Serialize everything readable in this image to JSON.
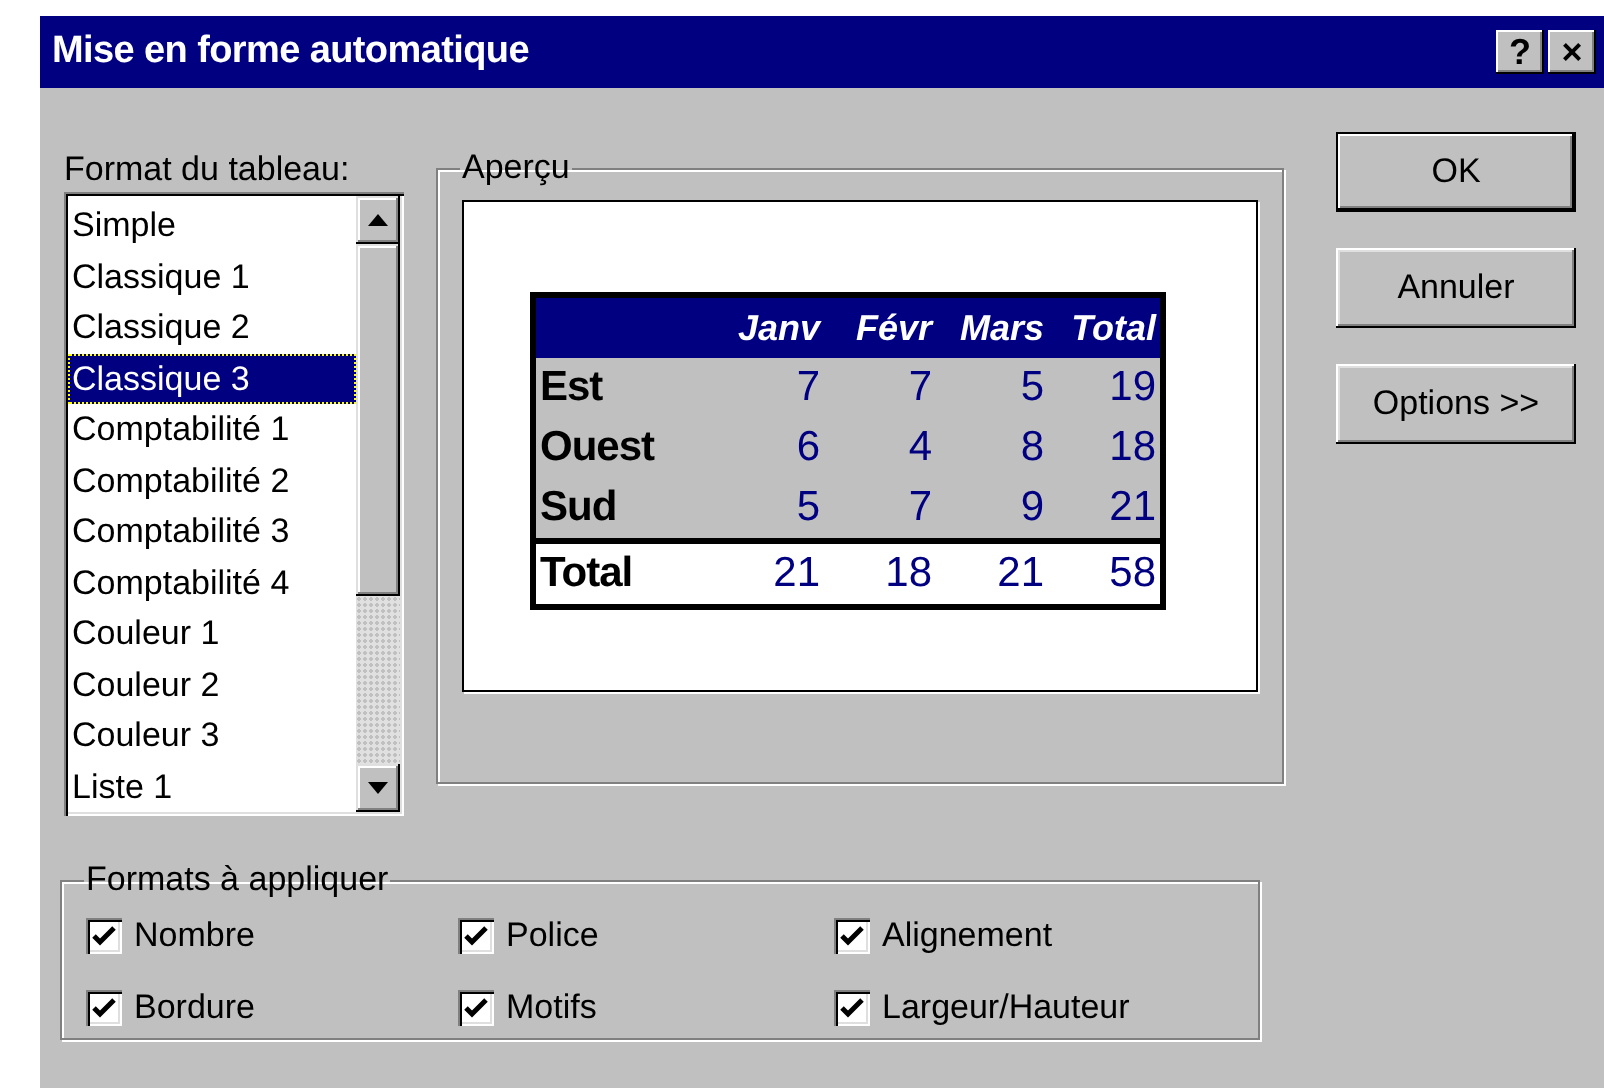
{
  "window": {
    "title": "Mise en forme automatique",
    "title_buttons": [
      "?",
      "×"
    ]
  },
  "format_list": {
    "label": "Format du tableau:",
    "items": [
      {
        "label": "Simple",
        "selected": false
      },
      {
        "label": "Classique 1",
        "selected": false
      },
      {
        "label": "Classique 2",
        "selected": false
      },
      {
        "label": "Classique 3",
        "selected": true
      },
      {
        "label": "Comptabilité 1",
        "selected": false
      },
      {
        "label": "Comptabilité 2",
        "selected": false
      },
      {
        "label": "Comptabilité 3",
        "selected": false
      },
      {
        "label": "Comptabilité 4",
        "selected": false
      },
      {
        "label": "Couleur 1",
        "selected": false
      },
      {
        "label": "Couleur 2",
        "selected": false
      },
      {
        "label": "Couleur 3",
        "selected": false
      },
      {
        "label": "Liste 1",
        "selected": false
      }
    ]
  },
  "preview": {
    "title": "Aperçu",
    "columns": [
      "Janv",
      "Févr",
      "Mars",
      "Total"
    ],
    "rows": [
      {
        "kind": "body",
        "label": "Est",
        "values": [
          "7",
          "7",
          "5",
          "19"
        ]
      },
      {
        "kind": "body",
        "label": "Ouest",
        "values": [
          "6",
          "4",
          "8",
          "18"
        ]
      },
      {
        "kind": "body",
        "label": "Sud",
        "values": [
          "5",
          "7",
          "9",
          "21"
        ]
      },
      {
        "kind": "total",
        "label": "Total",
        "values": [
          "21",
          "18",
          "21",
          "58"
        ]
      }
    ]
  },
  "buttons": [
    {
      "label": "OK",
      "default": true
    },
    {
      "label": "Annuler",
      "default": false
    },
    {
      "label": "Options >>",
      "default": false
    }
  ],
  "formats": {
    "title": "Formats à appliquer",
    "options": [
      {
        "label": "Nombre",
        "checked": true
      },
      {
        "label": "Police",
        "checked": true
      },
      {
        "label": "Alignement",
        "checked": true
      },
      {
        "label": "Bordure",
        "checked": true
      },
      {
        "label": "Motifs",
        "checked": true
      },
      {
        "label": "Largeur/Hauteur",
        "checked": true
      }
    ]
  }
}
